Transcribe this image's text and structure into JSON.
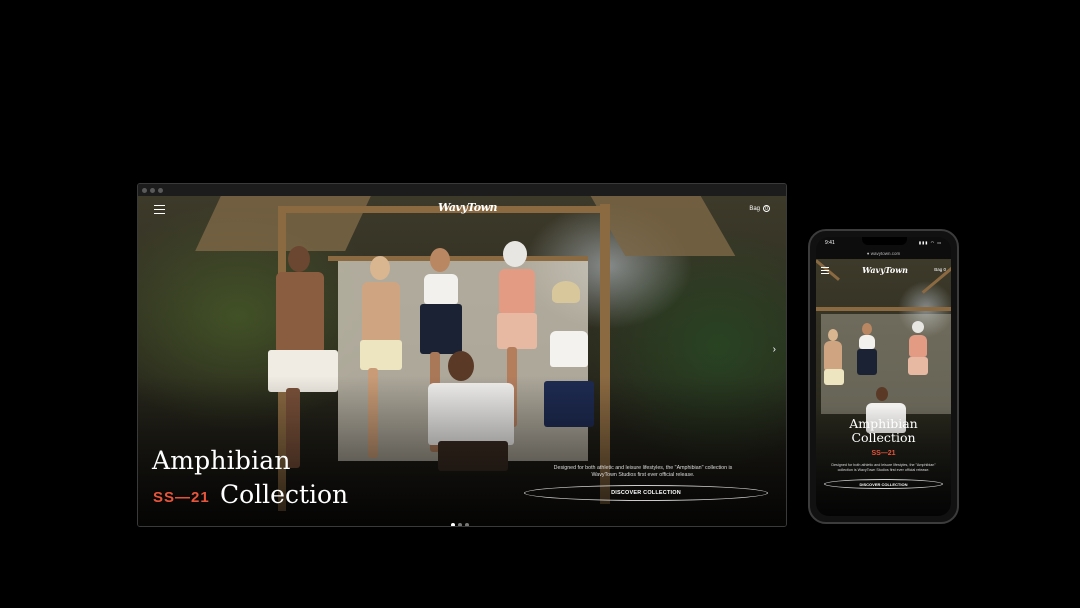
{
  "desktop": {
    "logo_text": "WavyTown",
    "bag_label": "Bag",
    "bag_count": "0",
    "hero": {
      "title_line1": "Amphibian",
      "title_line2": "Collection",
      "season": "SS—21",
      "description": "Designed for both athletic and leisure lifestyles, the \"Amphibian\" collection is WavyTown Studios first ever official release.",
      "cta_label": "DISCOVER COLLECTION",
      "next_arrow": "›"
    },
    "pager": {
      "total": 3,
      "active_index": 0
    }
  },
  "phone": {
    "status_time": "9:41",
    "status_icons": "▮▮▮ ◠ ▭",
    "url": "● wavytown.com",
    "logo_text": "WavyTown",
    "bag_label": "Bag",
    "bag_count": "0",
    "title_line1": "Amphibian",
    "title_line2": "Collection",
    "season": "SS—21",
    "description": "Designed for both athletic and leisure lifestyles, the \"Amphibian\" collection is WavyTown Studios first ever official release.",
    "cta_label": "DISCOVER COLLECTION"
  },
  "colors": {
    "accent": "#e8553a",
    "background": "#000000"
  },
  "icons": {
    "menu": "hamburger-icon",
    "next": "chevron-right-icon"
  }
}
